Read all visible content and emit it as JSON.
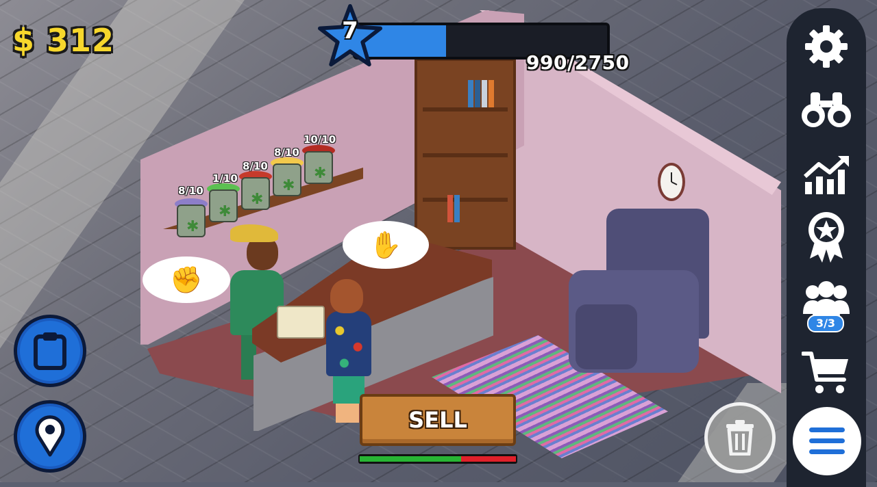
{
  "hud": {
    "money": "$ 312",
    "level": "7",
    "xp_text": "990/2750",
    "xp_current": 990,
    "xp_max": 2750,
    "xp_bar_color": "#2f86e6"
  },
  "shelf_jars": [
    {
      "label": "8/10",
      "lid_color": "#8d7ec9"
    },
    {
      "label": "1/10",
      "lid_color": "#5cc051"
    },
    {
      "label": "8/10",
      "lid_color": "#c63a2b"
    },
    {
      "label": "8/10",
      "lid_color": "#f2c94c"
    },
    {
      "label": "10/10",
      "lid_color": "#b32b22"
    }
  ],
  "bubbles": {
    "seller": "✊",
    "customer": "✋"
  },
  "sidebar": {
    "workers_badge": "3/3",
    "icons": [
      "gear-icon",
      "binoculars-icon",
      "stats-chart-icon",
      "award-badge-icon",
      "workers-icon",
      "shopping-cart-icon"
    ]
  },
  "actions": {
    "sell_label": "SELL",
    "deal_meter_green_fraction": 0.65
  },
  "colors": {
    "money": "#f7d72c",
    "blue_button": "#1f6fd8",
    "sell_button": "#c9843b"
  }
}
